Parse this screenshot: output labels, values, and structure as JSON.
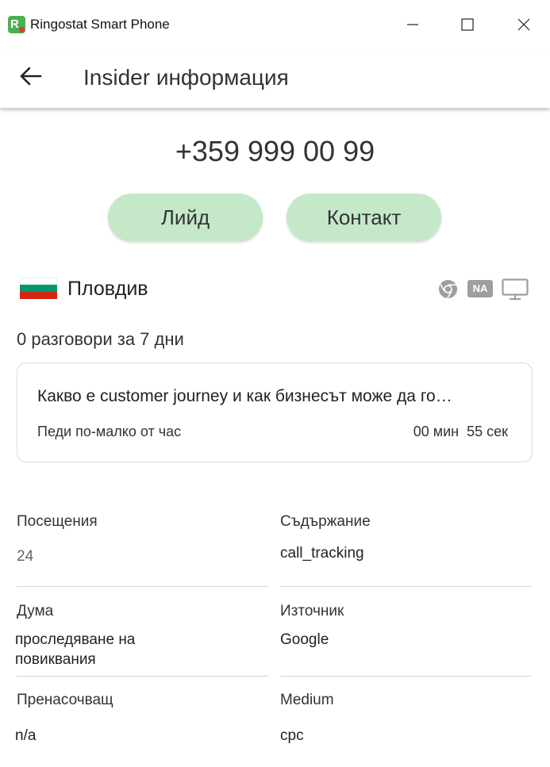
{
  "window": {
    "app_title": "Ringostat Smart Phone",
    "logo_letter": "R"
  },
  "header": {
    "title": "Insider информация"
  },
  "phone_number": "+359 999 00 99",
  "actions": {
    "lead_label": "Лийд",
    "contact_label": "Контакт"
  },
  "location": {
    "city": "Пловдив",
    "flag_colors": [
      "#ffffff",
      "#00966e",
      "#d62612"
    ],
    "device_icons": [
      "chrome-icon",
      "na-badge",
      "desktop-icon"
    ],
    "na_label": "NA"
  },
  "calls_summary": "0 разговори за 7 дни",
  "session": {
    "title": "Какво е customer journey и как бизнесът може да го…",
    "note": "Педи по-малко от час",
    "duration": "00 мин  55 сек"
  },
  "fields": {
    "visits": {
      "label": "Посещения",
      "value": "24"
    },
    "content": {
      "label": "Съдържание",
      "value": "call_tracking"
    },
    "keyword": {
      "label": "Дума",
      "value": "проследяване на повиквания"
    },
    "source": {
      "label": "Източник",
      "value": "Google"
    },
    "referrer": {
      "label": "Пренасочващ",
      "value": "n/a"
    },
    "medium": {
      "label": "Medium",
      "value": "cpc"
    }
  },
  "colors": {
    "button_bg": "#c5e8c9",
    "accent_green": "#4caf50"
  }
}
